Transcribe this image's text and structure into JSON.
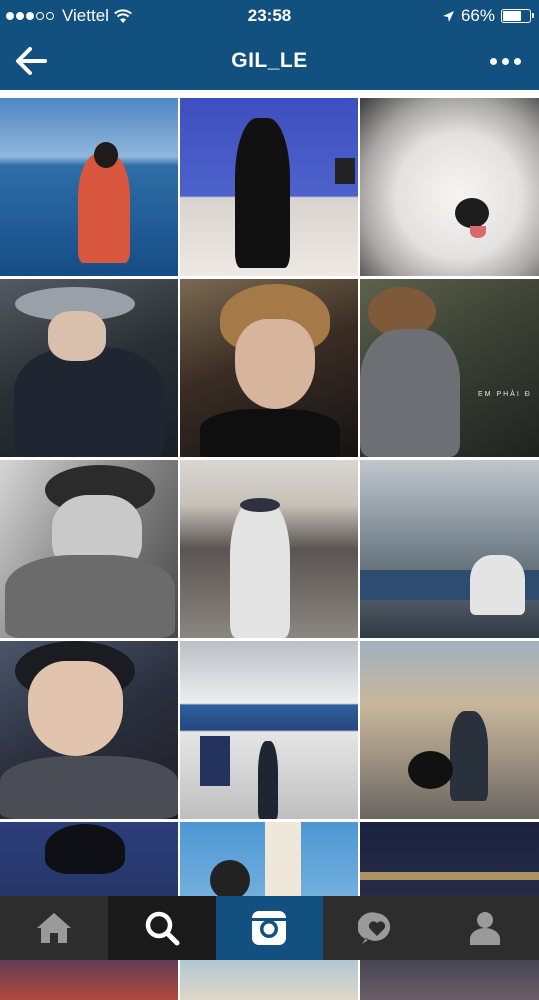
{
  "status_bar": {
    "carrier": "Viettel",
    "time": "23:58",
    "battery_percent": "66%",
    "battery_level": 0.66
  },
  "header": {
    "title": "GIL_LE"
  },
  "tabbar": {
    "items": [
      "home-icon",
      "search-icon",
      "camera-icon",
      "activity-icon",
      "profile-icon"
    ]
  },
  "colors": {
    "brand": "#12507f",
    "tabbar_bg": "#2d2d2d"
  },
  "grid": {
    "caption_tile_6": "EM PHẢI Đ"
  }
}
